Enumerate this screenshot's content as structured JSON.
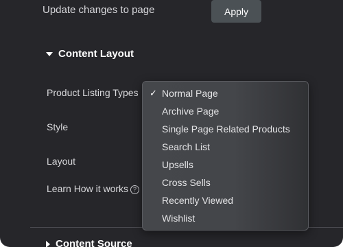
{
  "top": {
    "update_text": "Update changes to page",
    "apply_label": "Apply"
  },
  "section1": {
    "title": "Content Layout"
  },
  "fields": {
    "product_listing_types": "Product Listing Types",
    "style": "Style",
    "layout": "Layout",
    "learn": "Learn How it works",
    "help_glyph": "?"
  },
  "dropdown": {
    "selected_check": "✓",
    "options": [
      "Normal Page",
      "Archive Page",
      "Single Page Related Products",
      "Search List",
      "Upsells",
      "Cross Sells",
      "Recently Viewed",
      "Wishlist"
    ],
    "selected_index": 0
  },
  "section2": {
    "title": "Content Source"
  }
}
